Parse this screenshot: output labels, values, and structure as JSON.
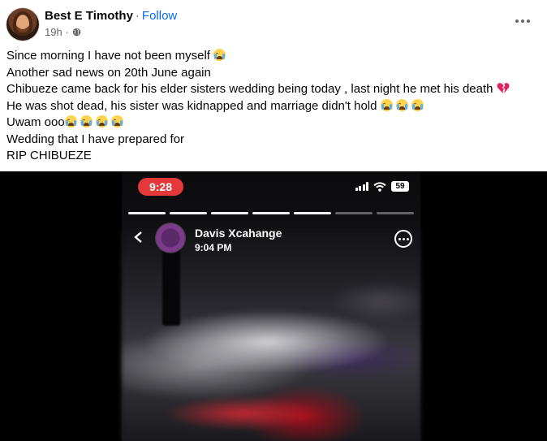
{
  "post": {
    "author": "Best E Timothy",
    "separator": "·",
    "follow_label": "Follow",
    "time": "19h",
    "privacy_icon": "globe-icon",
    "more_icon": "more-options-icon"
  },
  "text_lines": [
    "Since morning I have not been myself ",
    "Another sad news on 20th June again",
    "Chibueze came back for his elder sisters wedding being today , last night  he met his death ",
    "He was shot dead, his sister was kidnapped and marriage didn't hold ",
    "Uwam ooo",
    "Wedding that I have prepared for",
    "RIP CHIBUEZE"
  ],
  "emoji": {
    "crying": "loudly-crying-face-icon",
    "broken_heart": "broken-heart-icon"
  },
  "media": {
    "status_time": "9:28",
    "battery": "59",
    "story_author": "Davis Xcahange",
    "story_time": "9:04 PM",
    "story_progress_segments": 7,
    "story_progress_active": 5
  }
}
